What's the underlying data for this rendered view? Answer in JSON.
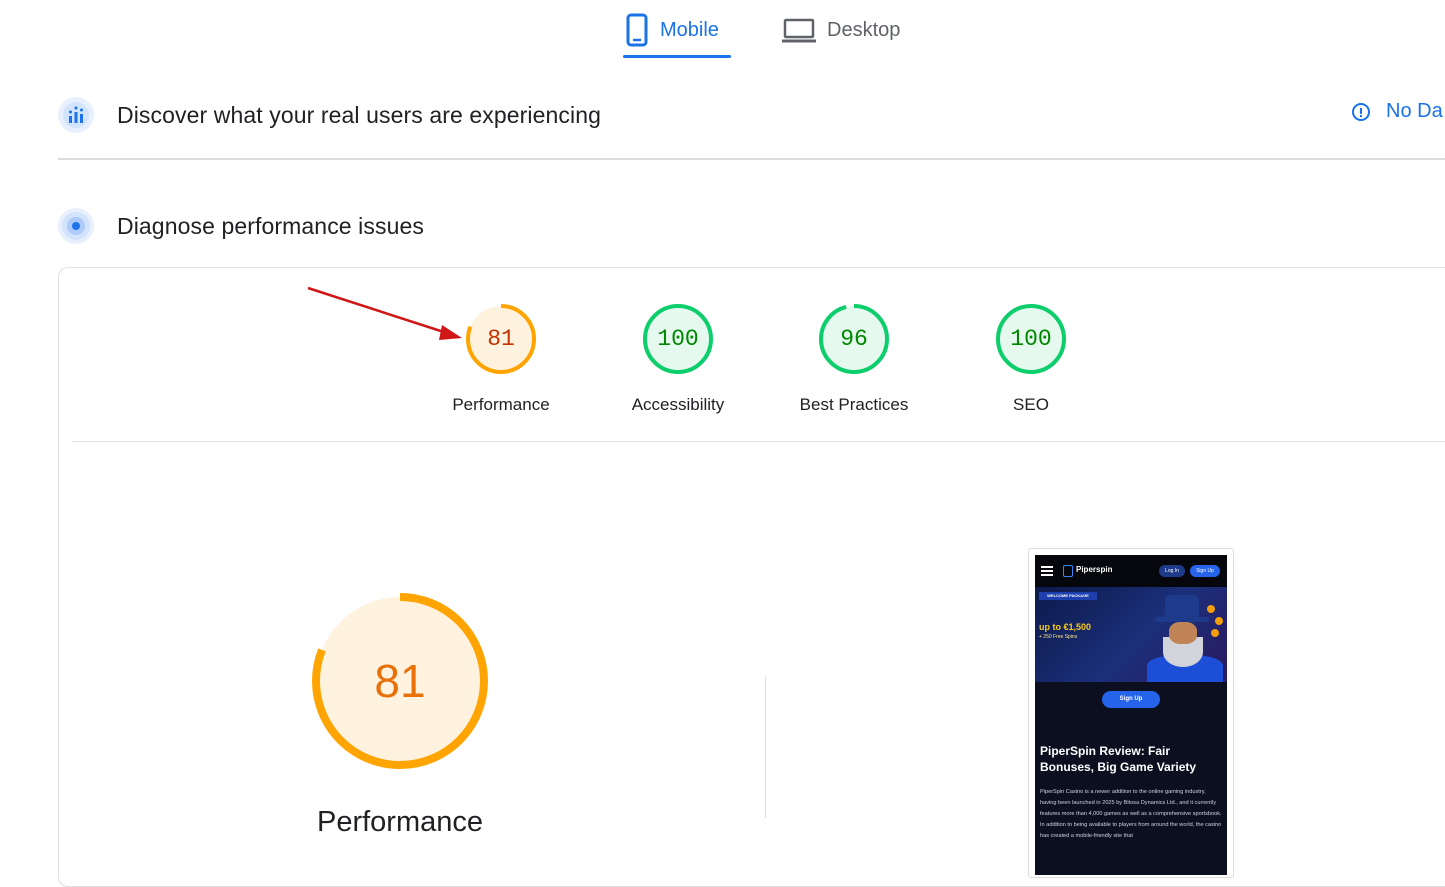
{
  "tabs": {
    "mobile": "Mobile",
    "desktop": "Desktop",
    "active": "mobile"
  },
  "crux": {
    "title": "Discover what your real users are experiencing",
    "no_data": "No Da"
  },
  "diagnose": {
    "title": "Diagnose performance issues"
  },
  "scores": [
    {
      "label": "Performance",
      "value": "81",
      "color": "#ffa400",
      "text_color": "#c33300",
      "fill": "#fff3e0"
    },
    {
      "label": "Accessibility",
      "value": "100",
      "color": "#0cce6b",
      "text_color": "#008800",
      "fill": "#e6f9ee"
    },
    {
      "label": "Best Practices",
      "value": "96",
      "color": "#0cce6b",
      "text_color": "#008800",
      "fill": "#e6f9ee"
    },
    {
      "label": "SEO",
      "value": "100",
      "color": "#0cce6b",
      "text_color": "#008800",
      "fill": "#e6f9ee"
    }
  ],
  "main_gauge": {
    "value": "81",
    "label": "Performance",
    "color": "#ffa400"
  },
  "screenshot": {
    "brand": "Piperspin",
    "login": "Log In",
    "signup_top": "Sign Up",
    "tag": "WELCOME PACKAGE",
    "offer": "up to €1,500",
    "offer_sub": "+ 250 Free Spins",
    "signup_main": "Sign Up",
    "headline": "PiperSpin Review: Fair Bonuses, Big Game Variety",
    "body": "PiperSpin Casino is a newer addition to the online gaming industry, having been launched in 2025 by Bitosa Dynamics Ltd., and it currently features more than 4,000 games as well as a comprehensive sportsbook. In addition to being available to players from around the world, the casino has created a mobile-friendly site that"
  },
  "colors": {
    "accent": "#1a73e8",
    "average": "#ffa400",
    "pass": "#0cce6b",
    "annotation_arrow": "#d01616"
  }
}
